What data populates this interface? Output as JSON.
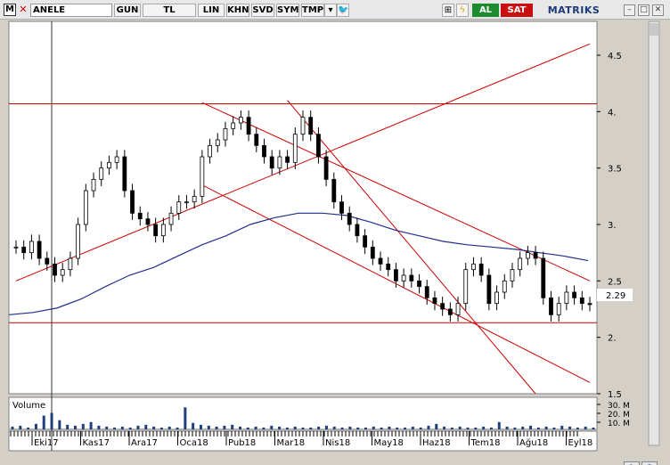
{
  "toolbar": {
    "logo": "M",
    "symbol": "ANELE",
    "period": "GUN",
    "currency": "TL",
    "scale": "LIN",
    "buttons": [
      "KHN",
      "SVD",
      "SYM",
      "TMP"
    ],
    "buy_label": "AL",
    "sell_label": "SAT",
    "brand": "MATRIKS"
  },
  "colors": {
    "price": "#000000",
    "moving_average": "#1f2f8f",
    "trendline": "#cc0000",
    "volume": "#1f3f7f",
    "chart_bg": "#ffffff"
  },
  "volume_panel": {
    "label": "Volume",
    "ticks": [
      "30. M",
      "20. M",
      "10. M"
    ]
  },
  "chart_data": {
    "type": "candlestick",
    "price_axis_ticks": [
      "4.5",
      "4.",
      "3.5",
      "3.",
      "2.5",
      "2.",
      "1.5"
    ],
    "last_price_label": "2.29",
    "ylim": [
      1.5,
      4.8
    ],
    "x_labels": [
      "Eki17",
      "Kas17",
      "Ara17",
      "Oca18",
      "Pub18",
      "Mar18",
      "Nis18",
      "May18",
      "Haz18",
      "Tem18",
      "Ağu18",
      "Eyl18"
    ],
    "grid": false,
    "close_series": [
      2.8,
      2.75,
      2.85,
      2.7,
      2.65,
      2.55,
      2.6,
      2.7,
      3.0,
      3.3,
      3.4,
      3.5,
      3.55,
      3.6,
      3.3,
      3.1,
      3.05,
      3.0,
      2.9,
      3.0,
      3.1,
      3.2,
      3.2,
      3.25,
      3.6,
      3.7,
      3.75,
      3.85,
      3.9,
      3.95,
      3.8,
      3.7,
      3.6,
      3.5,
      3.6,
      3.55,
      3.8,
      3.95,
      3.8,
      3.6,
      3.4,
      3.2,
      3.1,
      3.0,
      2.9,
      2.8,
      2.7,
      2.65,
      2.6,
      2.5,
      2.55,
      2.5,
      2.45,
      2.35,
      2.3,
      2.25,
      2.2,
      2.3,
      2.6,
      2.65,
      2.55,
      2.3,
      2.4,
      2.5,
      2.6,
      2.7,
      2.75,
      2.7,
      2.35,
      2.2,
      2.3,
      2.4,
      2.35,
      2.3,
      2.29
    ],
    "moving_average": [
      2.2,
      2.22,
      2.26,
      2.34,
      2.45,
      2.55,
      2.62,
      2.72,
      2.82,
      2.9,
      3.0,
      3.06,
      3.1,
      3.1,
      3.08,
      3.02,
      2.95,
      2.9,
      2.85,
      2.82,
      2.8,
      2.78,
      2.75,
      2.72,
      2.68
    ],
    "horizontal_lines": [
      4.07,
      2.13
    ],
    "volume_values": [
      3,
      4,
      2,
      6,
      15,
      18,
      10,
      5,
      4,
      6,
      8,
      4,
      3,
      2,
      3,
      2,
      4,
      5,
      3,
      2,
      3,
      2,
      24,
      7,
      5,
      4,
      3,
      4,
      5,
      3,
      2,
      3,
      2,
      4,
      3,
      2,
      3,
      2,
      2,
      3,
      4,
      3,
      2,
      3,
      2,
      2,
      3,
      2,
      3,
      2,
      2,
      3,
      2,
      4,
      6,
      3,
      2,
      3,
      2,
      2,
      3,
      2,
      8,
      3,
      2,
      3,
      4,
      2,
      3,
      2,
      4,
      3,
      2,
      3,
      2
    ]
  }
}
